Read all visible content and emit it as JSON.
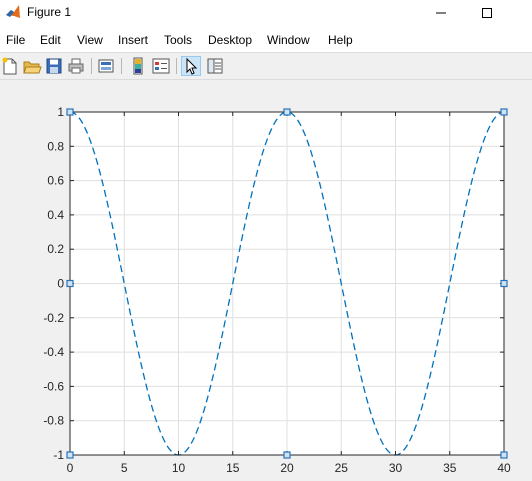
{
  "window": {
    "title": "Figure 1",
    "icon": "matlab-icon"
  },
  "menu": [
    "File",
    "Edit",
    "View",
    "Insert",
    "Tools",
    "Desktop",
    "Window",
    "Help"
  ],
  "toolbar": {
    "icons": [
      "new-figure-icon",
      "open-file-icon",
      "save-icon",
      "print-icon",
      "link-plot-icon",
      "insert-colorbar-icon",
      "insert-legend-icon",
      "edit-plot-icon",
      "property-inspector-icon"
    ],
    "selected": "edit-plot-icon"
  },
  "chart_data": {
    "type": "line",
    "series": [
      {
        "function": "cos(pi*x/10)",
        "x_range": [
          0,
          40
        ],
        "style": "dashed",
        "color": "#0072bd"
      }
    ],
    "x_ticks": [
      0,
      5,
      10,
      15,
      20,
      25,
      30,
      35,
      40
    ],
    "y_ticks": [
      -1,
      -0.8,
      -0.6,
      -0.4,
      -0.2,
      0,
      0.2,
      0.4,
      0.6,
      0.8,
      1
    ],
    "xlim": [
      0,
      40
    ],
    "ylim": [
      -1,
      1
    ],
    "grid": true,
    "title": "",
    "xlabel": "",
    "ylabel": "",
    "selection_handles": true
  }
}
